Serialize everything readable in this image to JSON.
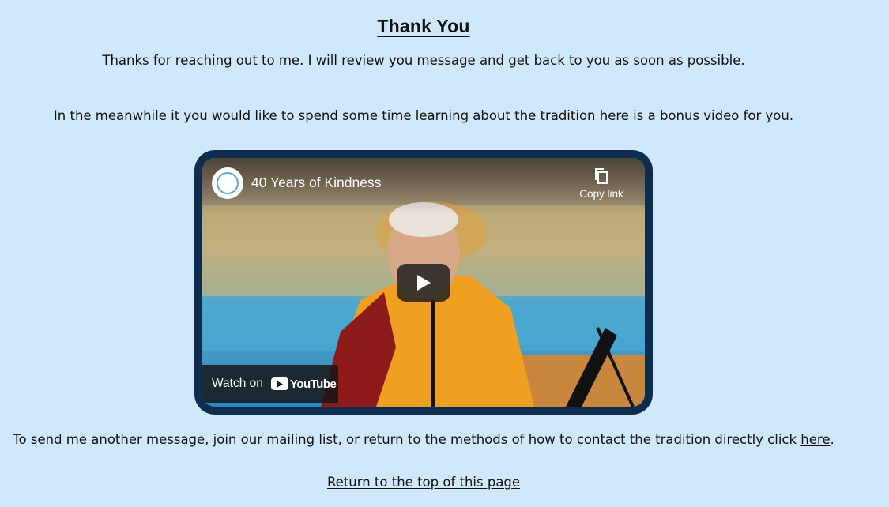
{
  "page": {
    "title": "Thank You",
    "intro": "Thanks for reaching out to me. I will review you message and get back to you as soon as possible.",
    "bonus": "In the meanwhile it you would like to spend some time learning about the tradition here is a bonus video for you.",
    "contact_prefix": "To send me another message, join our mailing list, or return to the methods of how to contact the tradition directly click ",
    "contact_link": "here",
    "contact_suffix": ".",
    "top_link": "Return to the top of this page"
  },
  "video": {
    "title": "40 Years of Kindness",
    "copy_label": "Copy link",
    "watch_label": "Watch on",
    "youtube_label": "YouTube",
    "play_icon": "play-icon",
    "copy_icon": "copy-icon",
    "frame_color": "#0e2d4e",
    "background_color": "#cfe8fb"
  }
}
